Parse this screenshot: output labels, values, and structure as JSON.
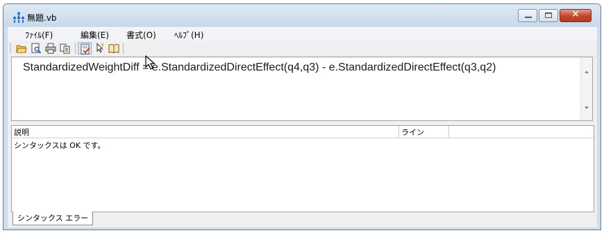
{
  "window": {
    "title": "無題.vb"
  },
  "menu": [
    {
      "label": "ﾌｧｲﾙ(F)"
    },
    {
      "label": "編集(E)"
    },
    {
      "label": "書式(O)"
    },
    {
      "label": "ﾍﾙﾌﾟ(H)"
    }
  ],
  "toolbar": {
    "buttons": [
      {
        "icon": "open-folder-icon"
      },
      {
        "icon": "print-preview-icon"
      },
      {
        "icon": "print-icon"
      },
      {
        "icon": "copy-icon"
      },
      {
        "icon": "check-syntax-icon",
        "pressed": true
      },
      {
        "icon": "help-pointer-icon"
      },
      {
        "icon": "book-icon"
      }
    ]
  },
  "editor": {
    "text": "StandardizedWeightDiff = e.StandardizedDirectEffect(q4,q3) - e.StandardizedDirectEffect(q3,q2)"
  },
  "output": {
    "columns": [
      "説明",
      "ライン"
    ],
    "rows": [
      {
        "description": "シンタックスは OK です。"
      }
    ]
  },
  "tabs": [
    {
      "label": "シンタックス エラー"
    }
  ]
}
